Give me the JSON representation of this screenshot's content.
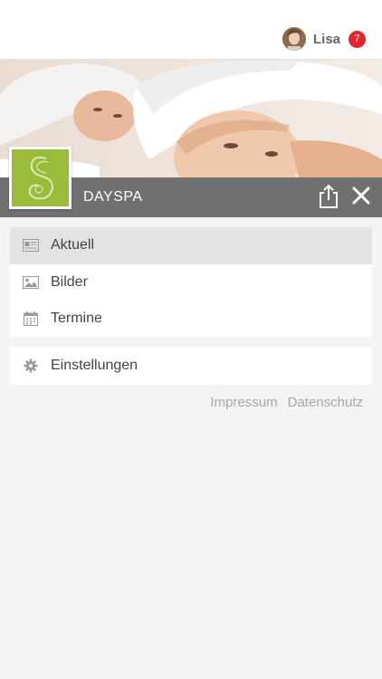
{
  "header": {
    "user_name": "Lisa",
    "notification_count": "7",
    "badge_color": "#e3242b"
  },
  "app": {
    "title": "DAYSPA",
    "brand_color": "#9bbb3a",
    "titlebar_color": "#707070"
  },
  "menu": {
    "main_items": [
      {
        "label": "Aktuell",
        "icon": "newspaper-icon",
        "active": true
      },
      {
        "label": "Bilder",
        "icon": "image-icon",
        "active": false
      },
      {
        "label": "Termine",
        "icon": "calendar-icon",
        "active": false
      }
    ],
    "settings_item": {
      "label": "Einstellungen",
      "icon": "gear-icon"
    }
  },
  "footer": {
    "impressum": "Impressum",
    "datenschutz": "Datenschutz"
  }
}
